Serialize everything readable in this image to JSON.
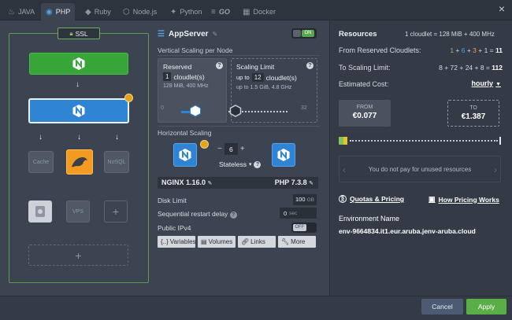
{
  "tabs": [
    {
      "label": "JAVA",
      "icon": "java-icon"
    },
    {
      "label": "PHP",
      "icon": "php-icon"
    },
    {
      "label": "Ruby",
      "icon": "ruby-icon"
    },
    {
      "label": "Node.js",
      "icon": "nodejs-icon"
    },
    {
      "label": "Python",
      "icon": "python-icon"
    },
    {
      "label": "GO",
      "icon": "go-icon"
    },
    {
      "label": "Docker",
      "icon": "docker-icon"
    }
  ],
  "active_tab": "PHP",
  "topology": {
    "ssl_label": "SSL",
    "services": {
      "cache": "Cache",
      "mysql": "MySQL",
      "nosql": "NoSQL",
      "vps": "VPS"
    }
  },
  "node": {
    "title": "AppServer",
    "toggle": "ON",
    "vertical_label": "Vertical Scaling per Node",
    "reserved": {
      "title": "Reserved",
      "count": "1",
      "unit": "cloudlet(s)",
      "sub": "128 MiB, 400 MHz"
    },
    "limit": {
      "title": "Scaling Limit",
      "prefix": "up to",
      "count": "12",
      "unit": "cloudlet(s)",
      "sub": "up to 1.5 GiB, 4.8 GHz"
    },
    "slider_min": "0",
    "slider_max": "32",
    "horizontal_label": "Horizontal Scaling",
    "nodes_count": "6",
    "stateless_label": "Stateless",
    "server_version": "NGINX 1.16.0",
    "php_version": "PHP 7.3.8",
    "disk_label": "Disk Limit",
    "disk_value": "100",
    "disk_unit": "GB",
    "restart_label": "Sequential restart delay",
    "restart_value": "0",
    "restart_unit": "sec",
    "ipv4_label": "Public IPv4",
    "ipv4_toggle": "OFF",
    "buttons": [
      "Variables",
      "Volumes",
      "Links",
      "More"
    ]
  },
  "resources": {
    "title": "Resources",
    "cloudlet_def": "1 cloudlet = 128 MiB + 400 MHz",
    "from_label": "From Reserved Cloudlets:",
    "from_parts": [
      "1",
      "6",
      "3",
      "1"
    ],
    "from_total": "11",
    "to_label": "To Scaling Limit:",
    "to_calc": "8 + 72 + 24 + 8 =",
    "to_total": "112",
    "cost_label": "Estimated Cost:",
    "period": "hourly",
    "from_price_label": "FROM",
    "from_price": "€0.077",
    "to_price_label": "TO",
    "to_price": "€1.387",
    "unused_note": "You do not pay for unused resources",
    "quotas_link": "Quotas & Pricing",
    "pricing_link": "How Pricing Works",
    "env_label": "Environment Name",
    "env_name": "env-9664834.it1.eur.aruba.jenv-aruba.cloud"
  },
  "footer": {
    "cancel": "Cancel",
    "apply": "Apply"
  },
  "colors": {
    "accent_blue": "#2f84d3",
    "green": "#38a539",
    "mysql_orange": "#f29a21",
    "apply_green": "#5aae47"
  }
}
